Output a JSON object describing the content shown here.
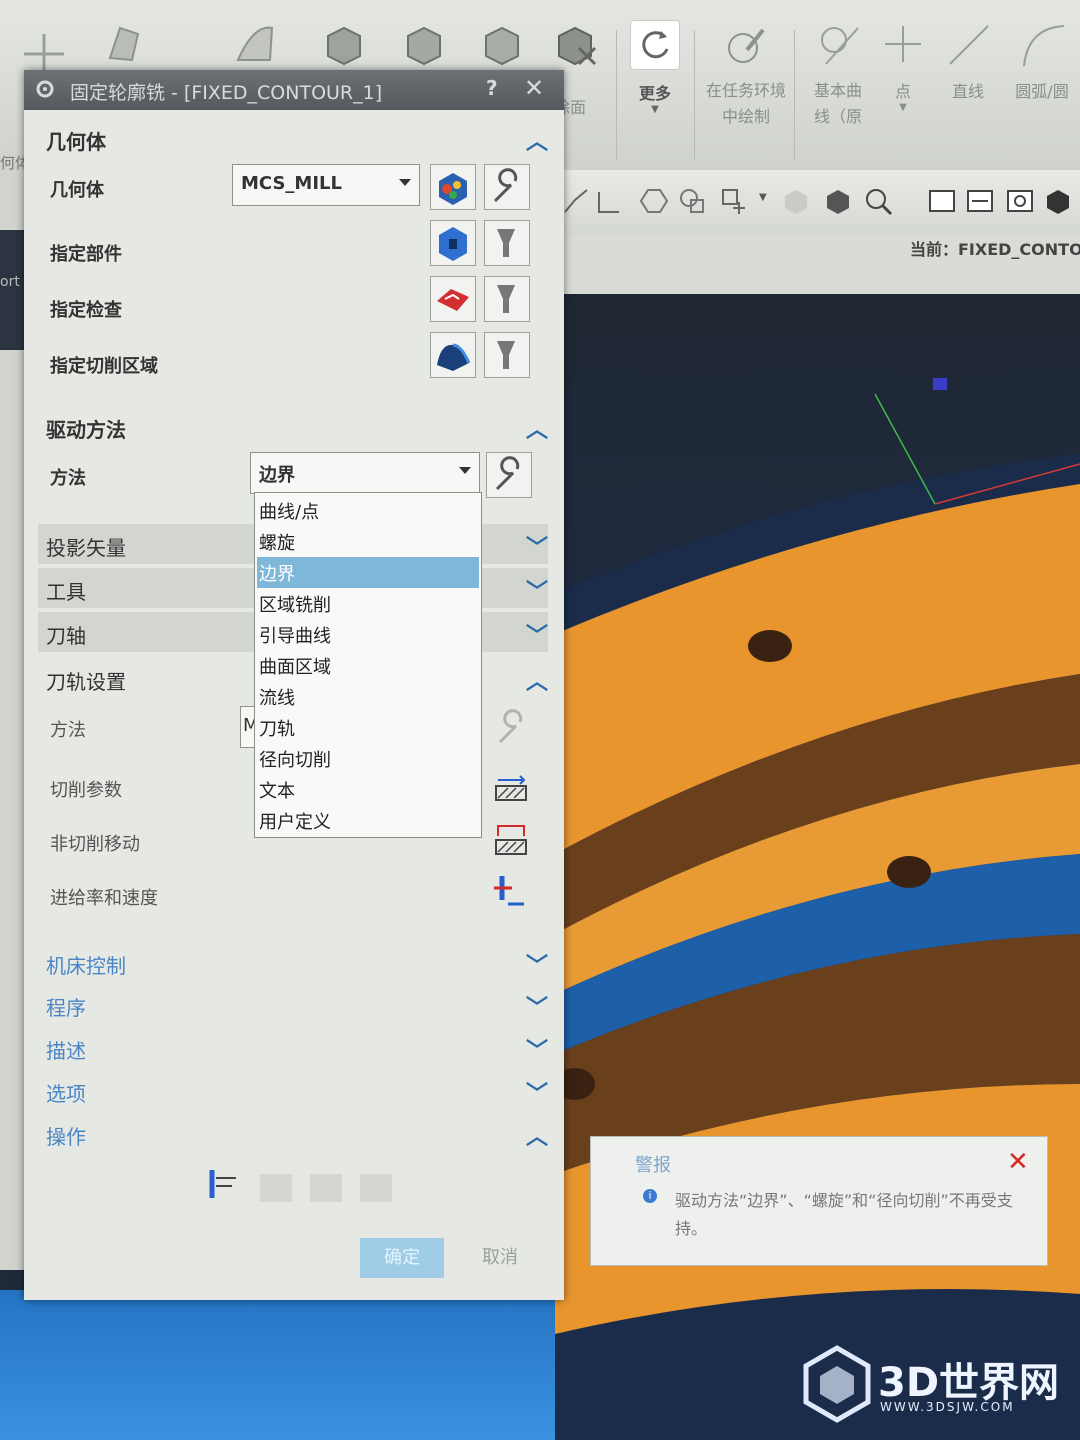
{
  "ribbon": {
    "items": [
      {
        "label": "除面",
        "icon": "remove-face-icon"
      },
      {
        "label": "更多",
        "icon": "refresh-icon"
      },
      {
        "label": "在任务环境中绘制",
        "icon": "sketch-pen-icon"
      },
      {
        "label": "基本曲线（原",
        "icon": "basic-curve-icon"
      },
      {
        "label": "点",
        "icon": "point-icon"
      },
      {
        "label": "直线",
        "icon": "line-icon"
      },
      {
        "label": "圆弧/圆",
        "icon": "arc-icon"
      }
    ],
    "left_fragment": "何体",
    "left_fragment2": "ort"
  },
  "view": {
    "current_label": "当前：FIXED_CONTO"
  },
  "dialog": {
    "title": "固定轮廓铣 - [FIXED_CONTOUR_1]",
    "help": "?",
    "close": "✕",
    "geometry": {
      "header": "几何体",
      "geom_label": "几何体",
      "geom_value": "MCS_MILL",
      "part_label": "指定部件",
      "check_label": "指定检查",
      "cut_area_label": "指定切削区域"
    },
    "drive": {
      "header": "驱动方法",
      "method_label": "方法",
      "method_value": "边界",
      "options": [
        "曲线/点",
        "螺旋",
        "边界",
        "区域铣削",
        "引导曲线",
        "曲面区域",
        "流线",
        "刀轨",
        "径向切削",
        "文本",
        "用户定义"
      ],
      "selected_index": 2
    },
    "collapsed_sections": [
      "投影矢量",
      "工具",
      "刀轴"
    ],
    "path_settings": {
      "header": "刀轨设置",
      "method_label": "方法",
      "method_value_fragment": "M",
      "cut_params": "切削参数",
      "non_cut_moves": "非切削移动",
      "feeds_speeds": "进给率和速度"
    },
    "lower_sections": [
      "机床控制",
      "程序",
      "描述",
      "选项",
      "操作"
    ],
    "ok_label": "确定",
    "cancel_label": "取消"
  },
  "alert": {
    "title": "警报",
    "message": "驱动方法“边界”、“螺旋”和“径向切削”不再受支持。"
  },
  "watermark": {
    "name": "3D世界网",
    "url": "WWW.3DSJW.COM"
  },
  "colors": {
    "part_orange": "#e8952e",
    "part_brown": "#6a3f1c",
    "viewport_blue": "#2f86d6",
    "selected_item": "#7eb7d8",
    "alert_close": "#d42a2a"
  }
}
